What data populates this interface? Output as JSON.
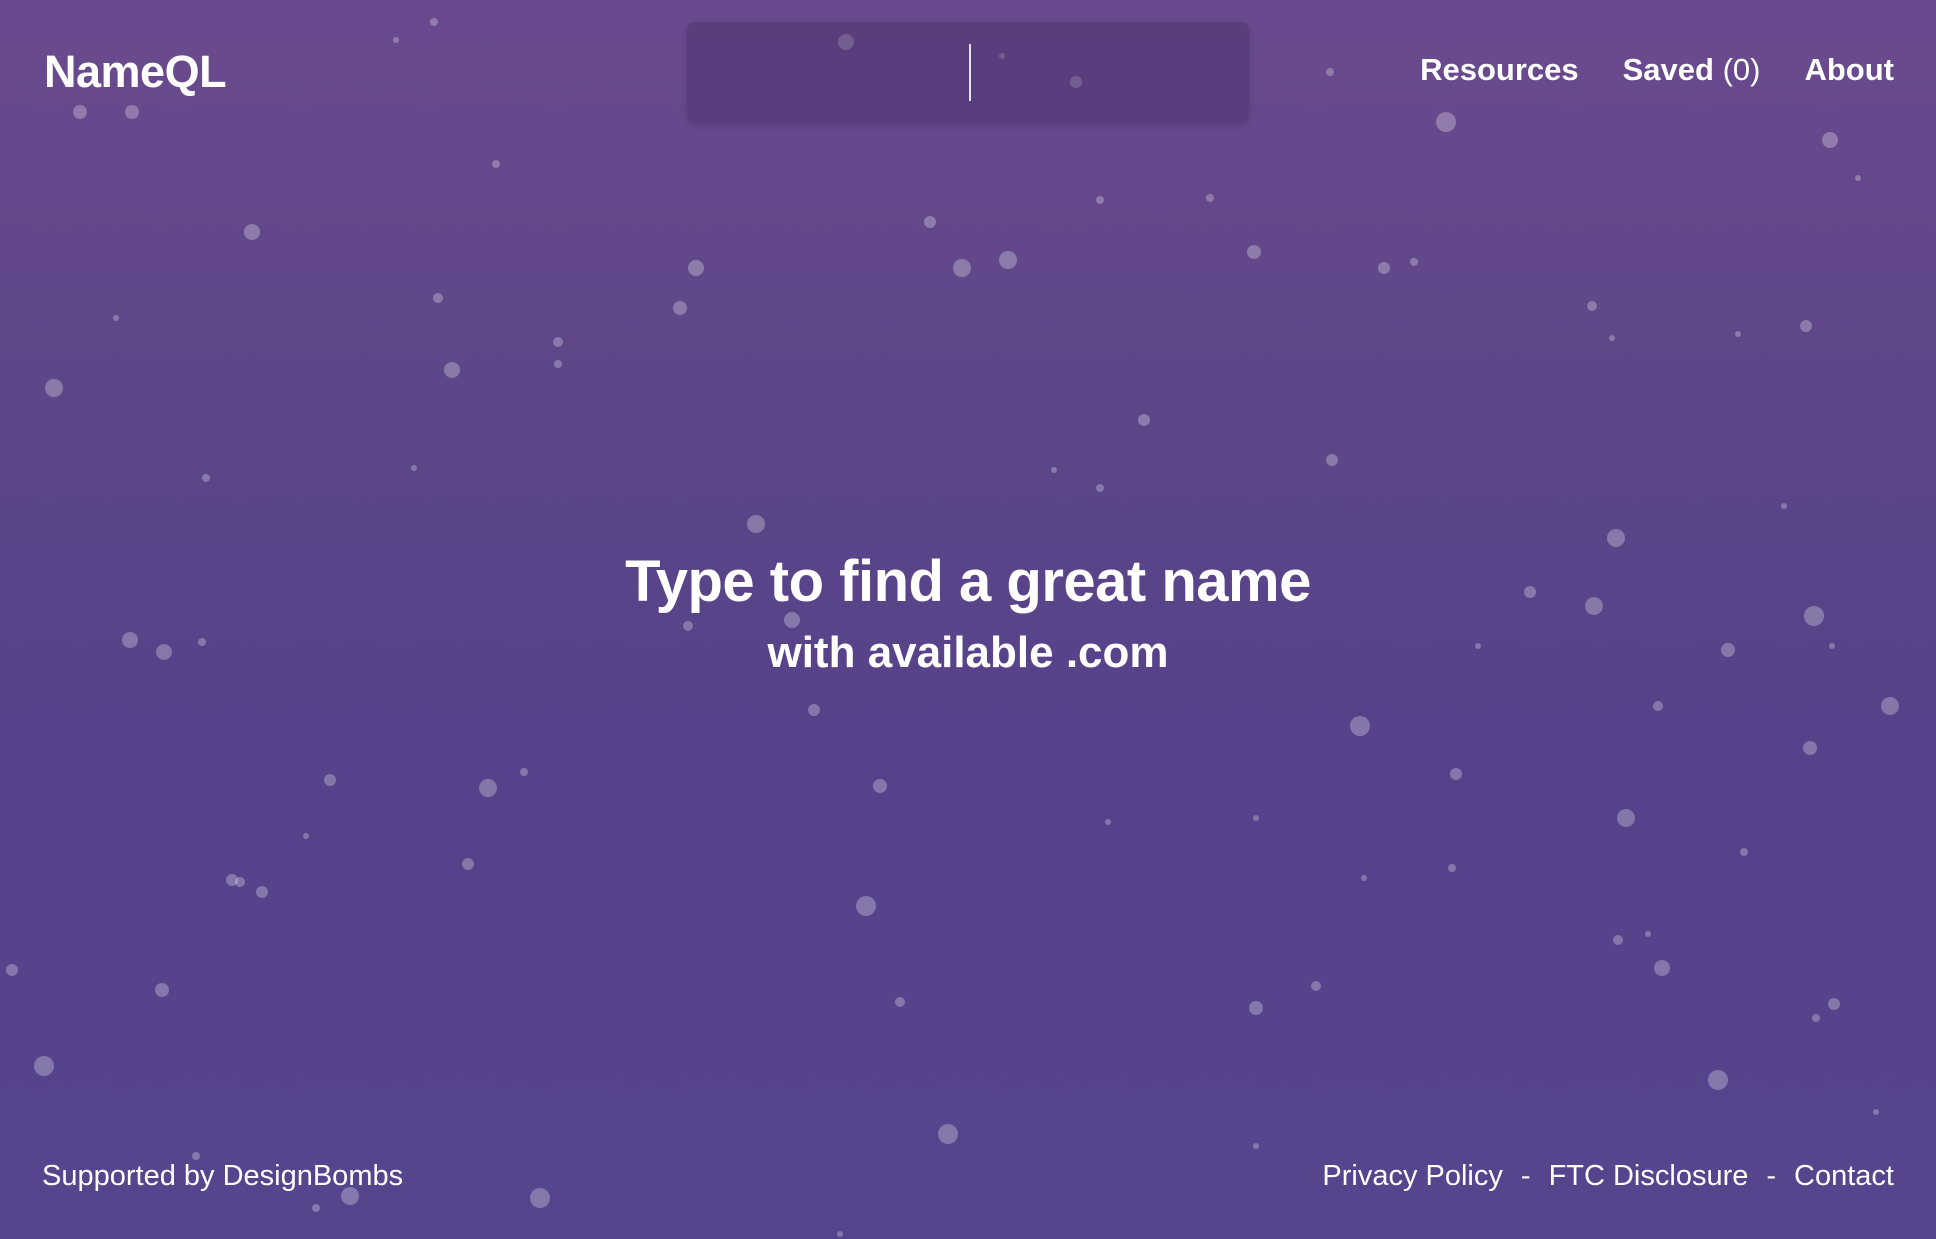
{
  "header": {
    "logo": "NameQL",
    "search": {
      "value": "",
      "placeholder": ""
    },
    "nav": {
      "resources": "Resources",
      "saved_label": "Saved",
      "saved_count": "(0)",
      "about": "About"
    }
  },
  "hero": {
    "title": "Type to find a great name",
    "subtitle": "with available .com"
  },
  "footer": {
    "supported": "Supported by DesignBombs",
    "links": {
      "privacy": "Privacy Policy",
      "ftc": "FTC Disclosure",
      "contact": "Contact"
    },
    "separator": "-"
  },
  "colors": {
    "background_top": "#6a4a8e",
    "background_bottom": "#56448c",
    "text": "#ffffff"
  }
}
